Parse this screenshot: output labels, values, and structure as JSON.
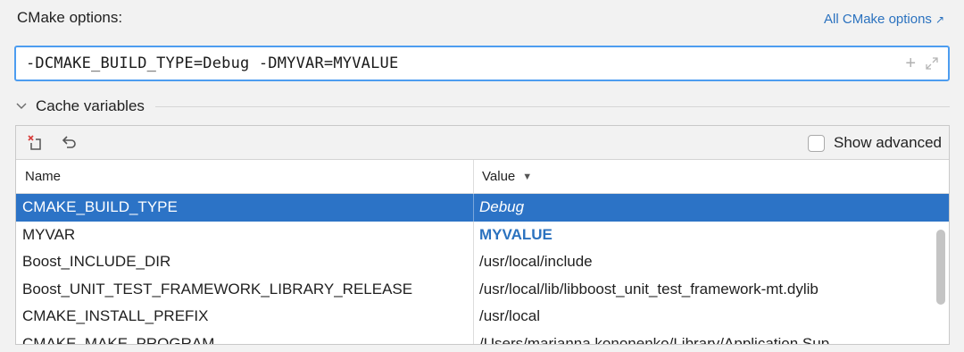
{
  "header": {
    "label": "CMake options:",
    "all_options_link": "All CMake options",
    "all_options_arrow": "↗"
  },
  "options_field": {
    "value": "-DCMAKE_BUILD_TYPE=Debug -DMYVAR=MYVALUE",
    "add_icon": "plus-icon",
    "expand_icon": "expand-icon"
  },
  "cache_section": {
    "title": "Cache variables",
    "expanded": true
  },
  "toolbar": {
    "remove_icon": "remove-variable-icon",
    "reset_icon": "undo-icon",
    "show_advanced_label": "Show advanced",
    "show_advanced_checked": false
  },
  "table": {
    "columns": [
      "Name",
      "Value"
    ],
    "sort_indicator": "▼",
    "rows": [
      {
        "name": "CMAKE_BUILD_TYPE",
        "value": "Debug",
        "selected": true,
        "modified": false
      },
      {
        "name": "MYVAR",
        "value": "MYVALUE",
        "selected": false,
        "modified": true
      },
      {
        "name": "Boost_INCLUDE_DIR",
        "value": "/usr/local/include",
        "selected": false,
        "modified": false
      },
      {
        "name": "Boost_UNIT_TEST_FRAMEWORK_LIBRARY_RELEASE",
        "value": "/usr/local/lib/libboost_unit_test_framework-mt.dylib",
        "selected": false,
        "modified": false
      },
      {
        "name": "CMAKE_INSTALL_PREFIX",
        "value": "/usr/local",
        "selected": false,
        "modified": false
      },
      {
        "name": "CMAKE_MAKE_PROGRAM",
        "value": "/Users/marianna.kononenko/Library/Application Sup",
        "selected": false,
        "modified": false
      }
    ]
  },
  "colors": {
    "accent": "#2b72bf",
    "selection": "#2c73c6",
    "focus_border": "#4d9df0"
  }
}
